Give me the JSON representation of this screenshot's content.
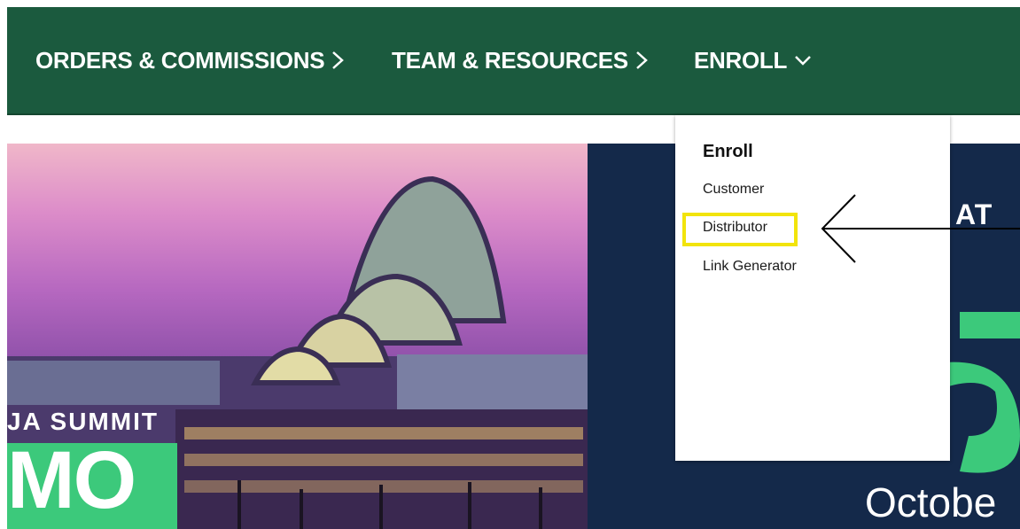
{
  "navbar": {
    "items": [
      {
        "label": "ORDERS & COMMISSIONS",
        "chevron": "›",
        "icon": "chevron-right-icon"
      },
      {
        "label": "TEAM & RESOURCES",
        "chevron": "›",
        "icon": "chevron-right-icon"
      },
      {
        "label": "ENROLL",
        "chevron": "⌄",
        "icon": "chevron-down-icon"
      }
    ],
    "color": "#1b5a3e"
  },
  "dropdown": {
    "heading": "Enroll",
    "items": [
      "Customer",
      "Distributor",
      "Link Generator"
    ],
    "highlighted": "Distributor",
    "highlight_color": "#f2e40b"
  },
  "banner": {
    "left_caption": "JA SUMMIT",
    "left_big": "MO",
    "right_top": "AT",
    "right_bottom": "Octobe",
    "accent_green": "#3cc97b",
    "navy": "#14294a"
  },
  "annotation": {
    "type": "arrow",
    "points_to": "Distributor",
    "icon": "arrow-left-icon"
  }
}
